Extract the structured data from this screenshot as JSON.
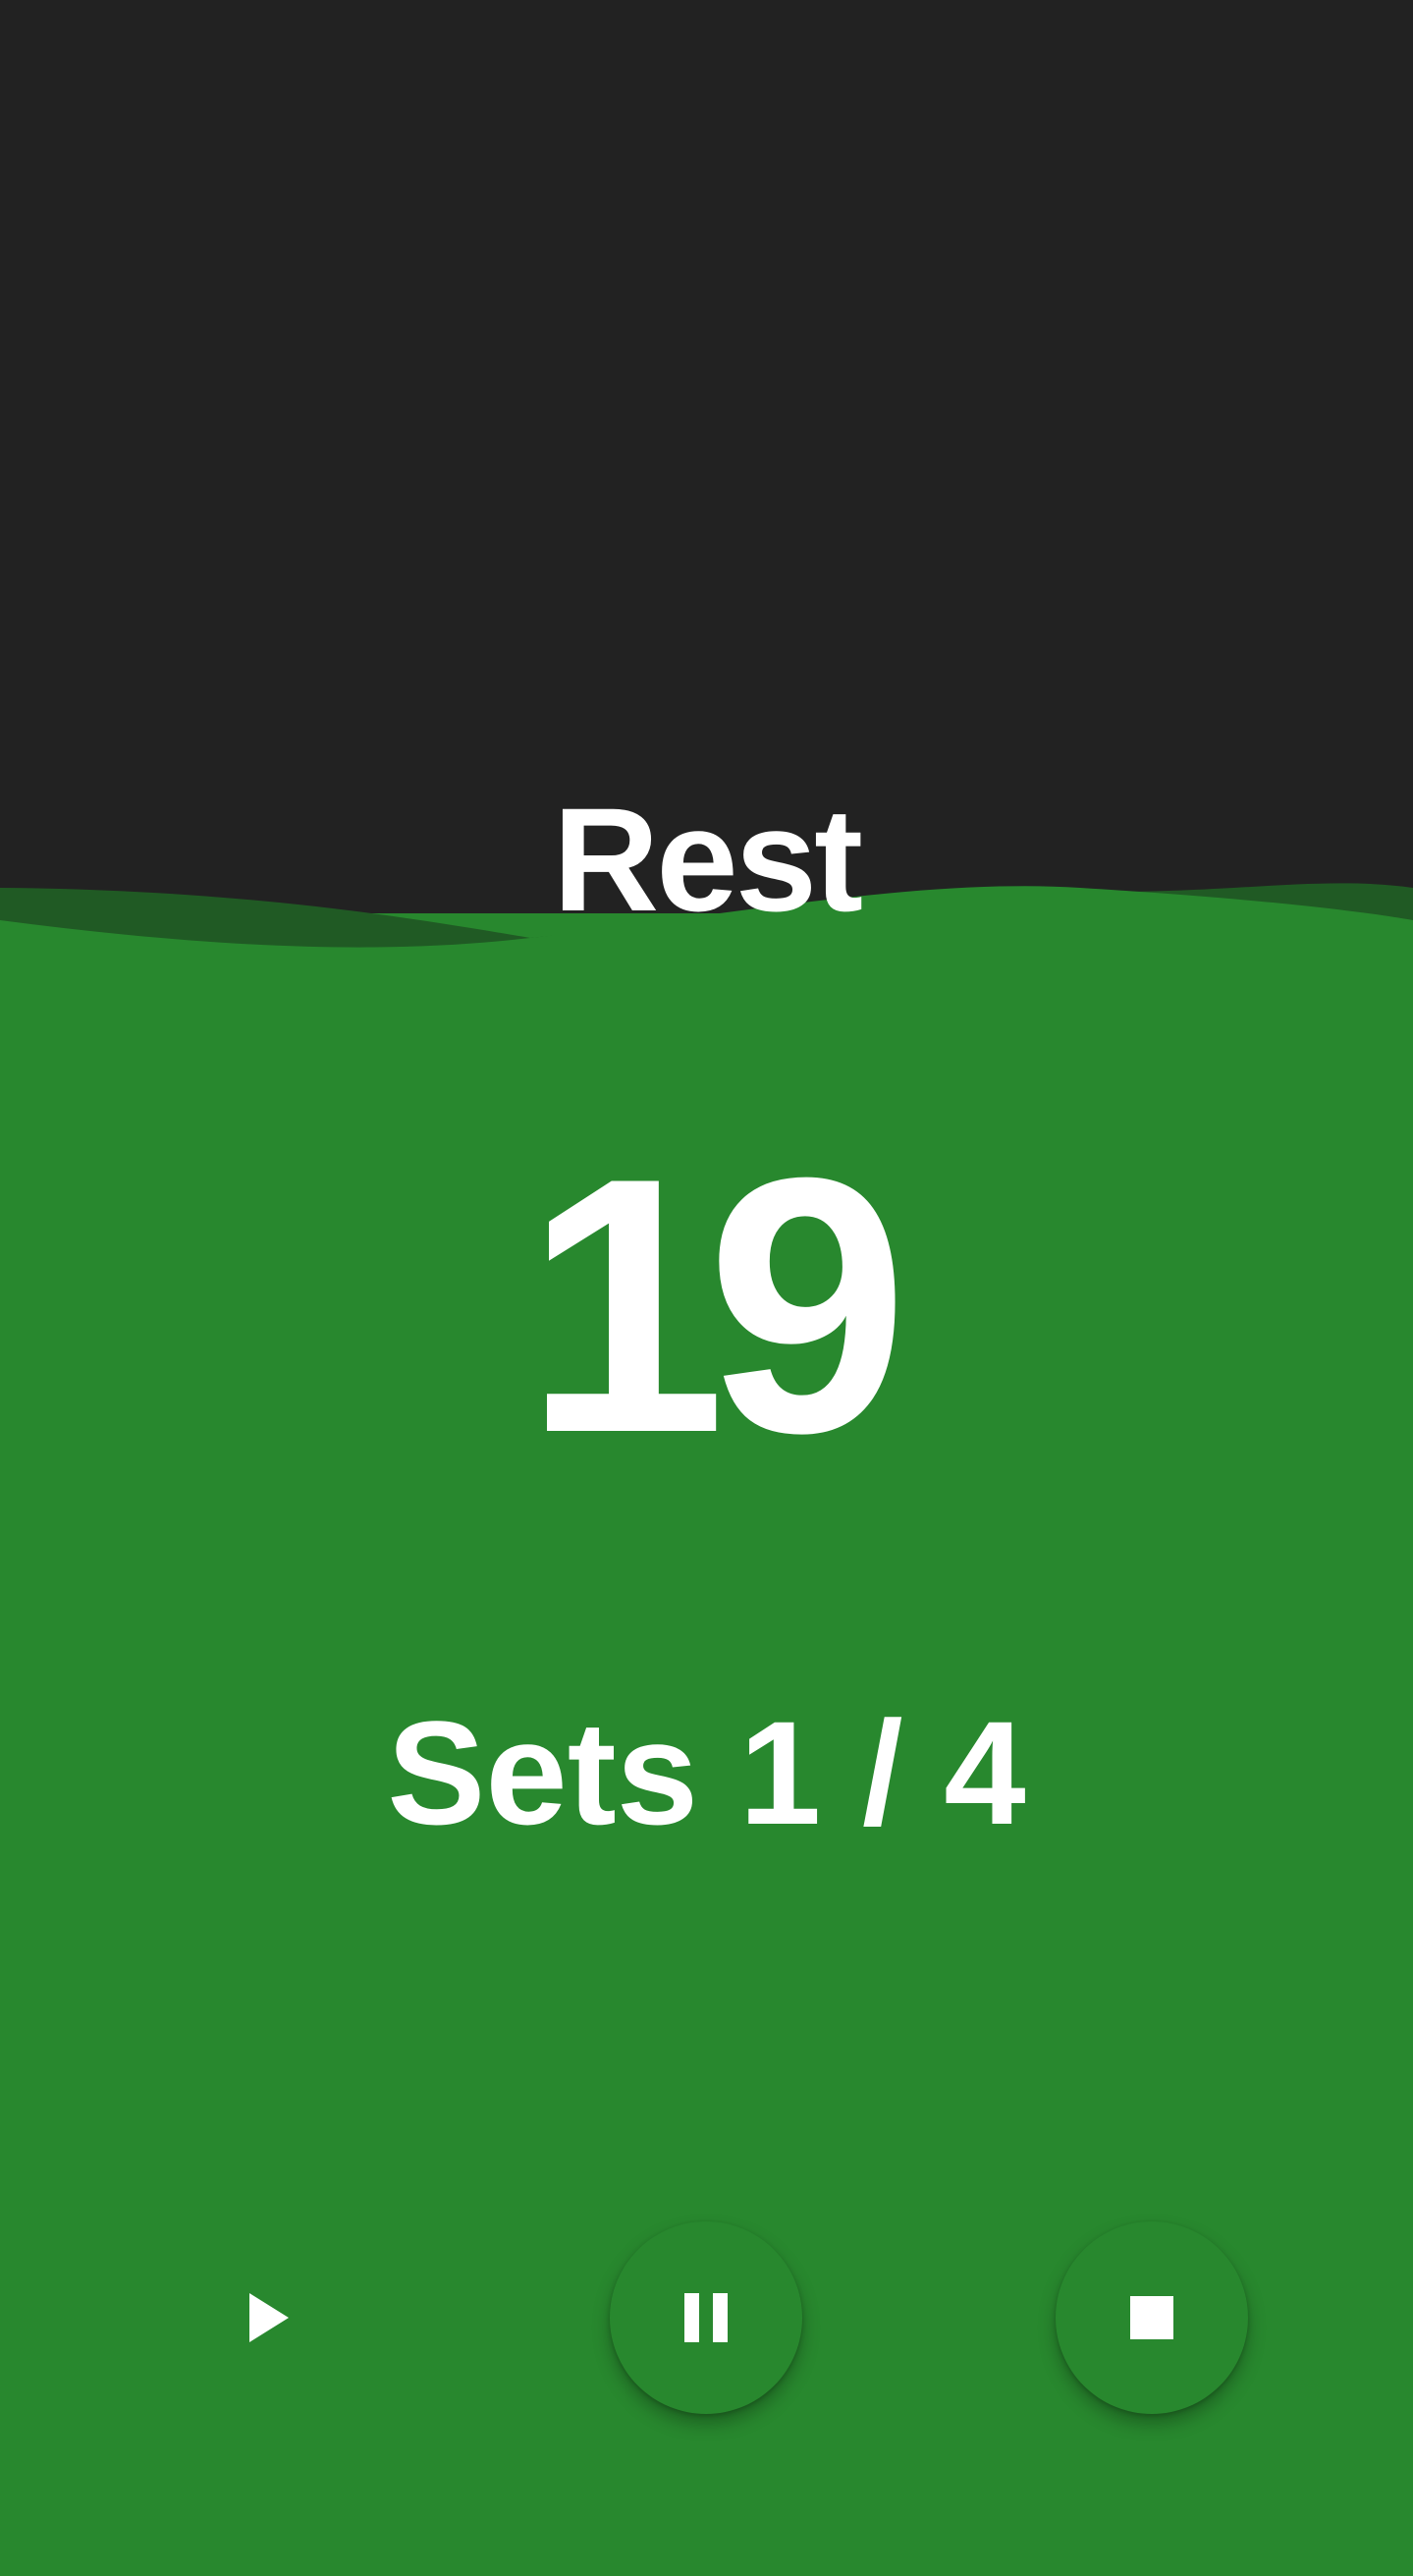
{
  "timer": {
    "phase": "Rest",
    "countdown": "19",
    "sets_label": "Sets 1 / 4"
  },
  "controls": {
    "play_icon": "play-icon",
    "pause_icon": "pause-icon",
    "stop_icon": "stop-icon"
  },
  "colors": {
    "background_top": "#222222",
    "accent_green": "#28882e",
    "wave_dark_green": "#205a24",
    "text": "#ffffff"
  }
}
